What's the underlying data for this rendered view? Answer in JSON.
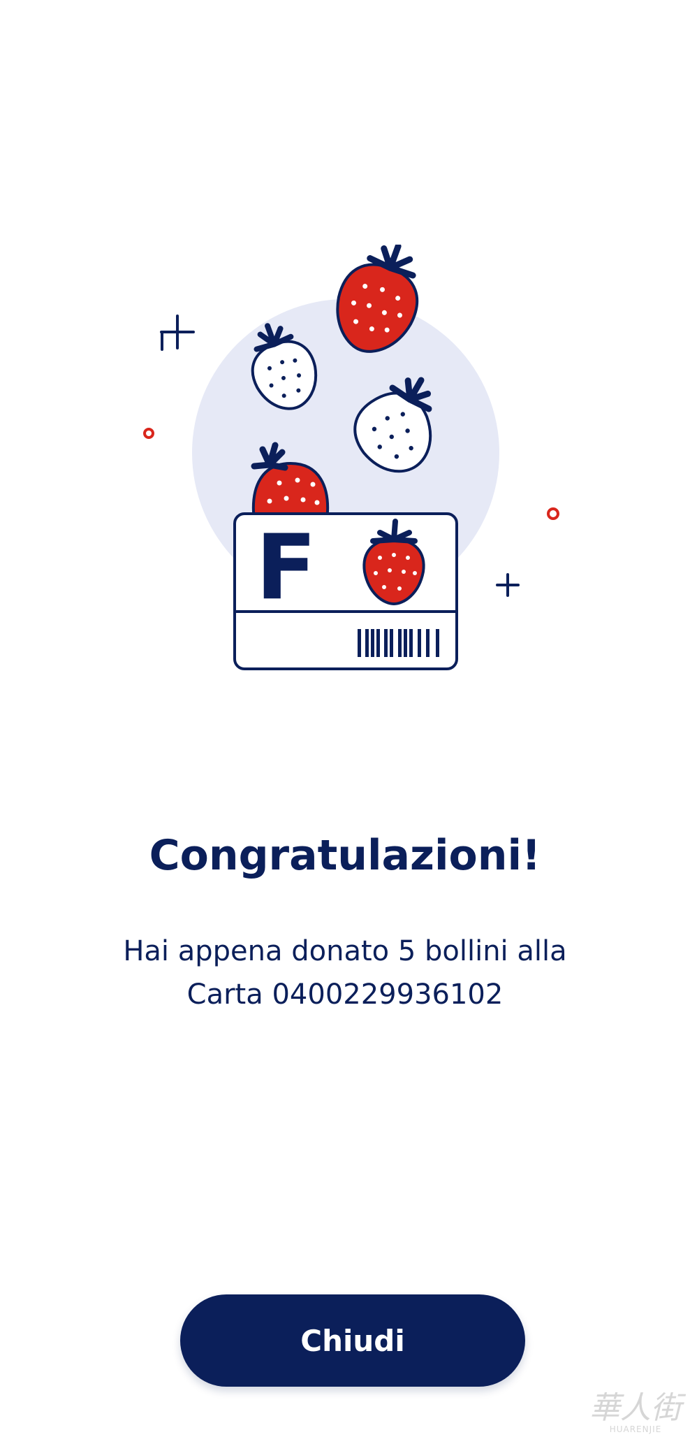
{
  "dialog": {
    "title": "Congratulazioni!",
    "message_line1": "Hai appena donato 5 bollini alla",
    "message_line2": "Carta 0400229936102",
    "close_label": "Chiudi"
  },
  "illustration": {
    "card_letter": "F",
    "colors": {
      "navy": "#0b1f5a",
      "red": "#d9261c",
      "circle_bg": "#e6e9f6",
      "white": "#ffffff"
    }
  },
  "watermark": {
    "logo_text": "華人街",
    "sub_text": "HUARENJIE"
  },
  "theme": {
    "primary": "#0b1f5a",
    "button_text": "#ffffff"
  }
}
